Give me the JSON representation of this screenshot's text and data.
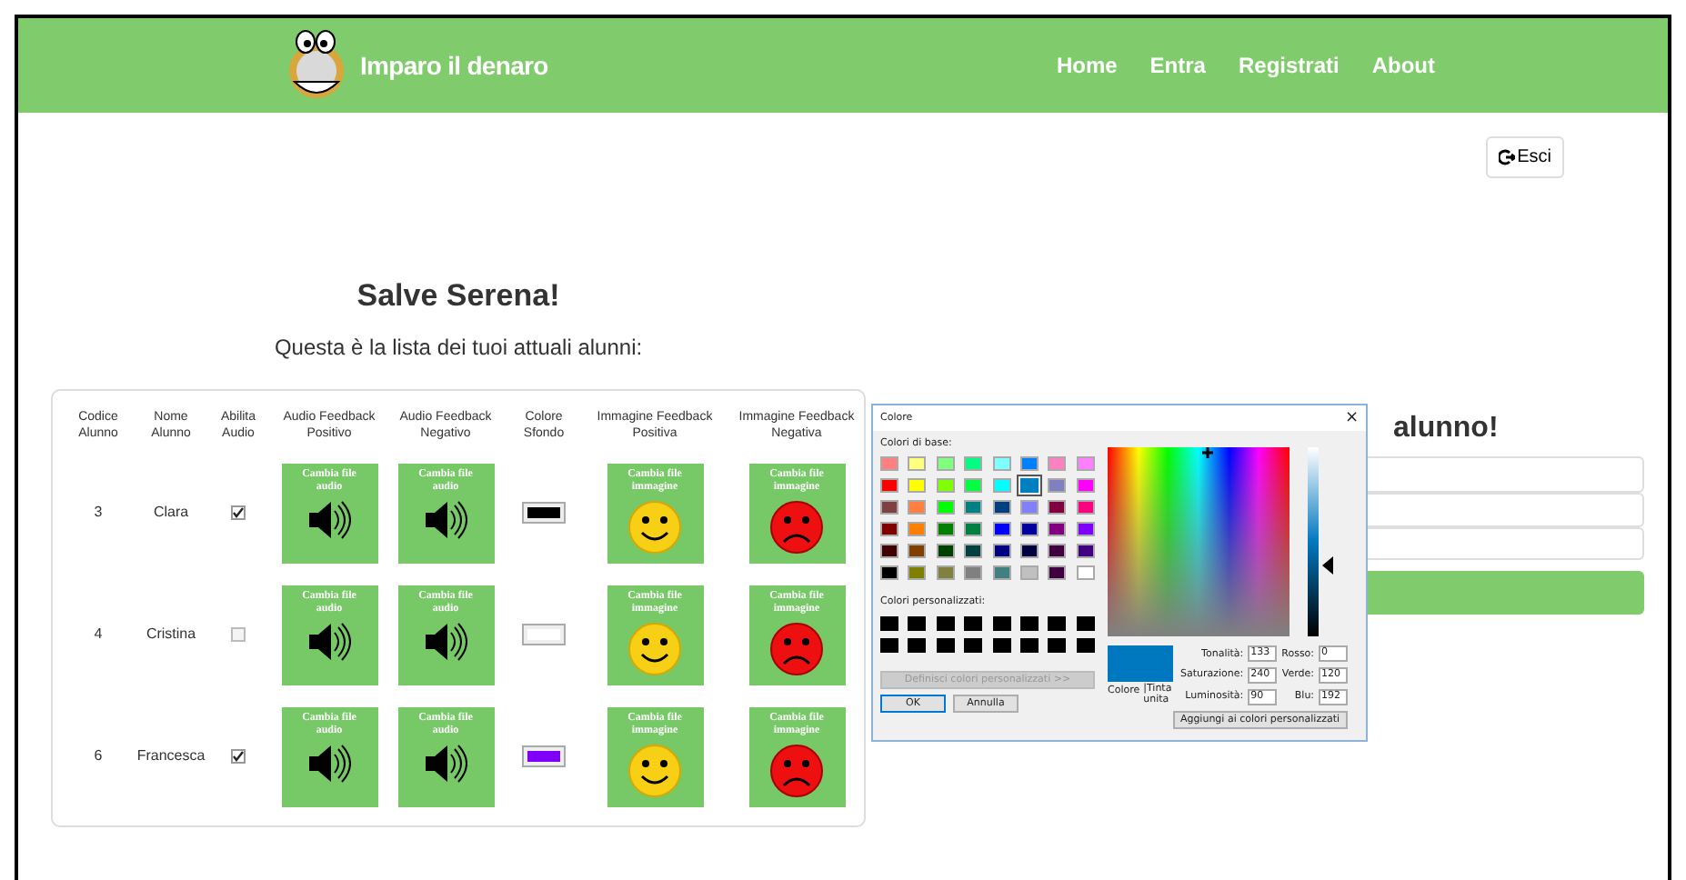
{
  "navbar": {
    "brand": "Imparo il denaro",
    "links": [
      "Home",
      "Entra",
      "Registrati",
      "About"
    ]
  },
  "logout_button": {
    "label": "Esci"
  },
  "greeting": "Salve Serena!",
  "subtitle": "Questa è la lista dei tuoi attuali alunni:",
  "table": {
    "columns": [
      "Codice Alunno",
      "Nome Alunno",
      "Abilita Audio",
      "Audio Feedback Positivo",
      "Audio Feedback Negativo",
      "Colore Sfondo",
      "Immagine Feedback Positiva",
      "Immagine Feedback Negativa"
    ],
    "rows": [
      {
        "code": "3",
        "name": "Clara",
        "audio_enabled": true,
        "audio_positive": "Cambia file audio",
        "audio_negative": "Cambia file audio",
        "color": "#000000",
        "image_positive": "Cambia file immagine",
        "image_negative": "Cambia file immagine"
      },
      {
        "code": "4",
        "name": "Cristina",
        "audio_enabled": false,
        "audio_positive": "Cambia file audio",
        "audio_negative": "Cambia file audio",
        "color": "#ffffff",
        "image_positive": "Cambia file immagine",
        "image_negative": "Cambia file immagine"
      },
      {
        "code": "6",
        "name": "Francesca",
        "audio_enabled": true,
        "audio_positive": "Cambia file audio",
        "audio_negative": "Cambia file audio",
        "color": "#8000ff",
        "image_positive": "Cambia file immagine",
        "image_negative": "Cambia file immagine"
      }
    ]
  },
  "add_form": {
    "title": "alunno!"
  },
  "color_dialog": {
    "title": "Colore",
    "close": "×",
    "basic_label": "Colori di base:",
    "basic_colors": [
      {
        "color": "#ff8080",
        "selected": false
      },
      {
        "color": "#ffff80",
        "selected": false
      },
      {
        "color": "#80ff80",
        "selected": false
      },
      {
        "color": "#00ff80",
        "selected": false
      },
      {
        "color": "#80ffff",
        "selected": false
      },
      {
        "color": "#0080ff",
        "selected": false
      },
      {
        "color": "#ff80c0",
        "selected": false
      },
      {
        "color": "#ff80ff",
        "selected": false
      },
      {
        "color": "#ff0000",
        "selected": false
      },
      {
        "color": "#ffff00",
        "selected": false
      },
      {
        "color": "#80ff00",
        "selected": false
      },
      {
        "color": "#00ff40",
        "selected": false
      },
      {
        "color": "#00ffff",
        "selected": false
      },
      {
        "color": "#0080c0",
        "selected": true
      },
      {
        "color": "#8080c0",
        "selected": false
      },
      {
        "color": "#ff00ff",
        "selected": false
      },
      {
        "color": "#804040",
        "selected": false
      },
      {
        "color": "#ff8040",
        "selected": false
      },
      {
        "color": "#00ff00",
        "selected": false
      },
      {
        "color": "#008080",
        "selected": false
      },
      {
        "color": "#004080",
        "selected": false
      },
      {
        "color": "#8080ff",
        "selected": false
      },
      {
        "color": "#800040",
        "selected": false
      },
      {
        "color": "#ff0080",
        "selected": false
      },
      {
        "color": "#800000",
        "selected": false
      },
      {
        "color": "#ff8000",
        "selected": false
      },
      {
        "color": "#008000",
        "selected": false
      },
      {
        "color": "#008040",
        "selected": false
      },
      {
        "color": "#0000ff",
        "selected": false
      },
      {
        "color": "#0000a0",
        "selected": false
      },
      {
        "color": "#800080",
        "selected": false
      },
      {
        "color": "#8000ff",
        "selected": false
      },
      {
        "color": "#400000",
        "selected": false
      },
      {
        "color": "#804000",
        "selected": false
      },
      {
        "color": "#004000",
        "selected": false
      },
      {
        "color": "#004040",
        "selected": false
      },
      {
        "color": "#000080",
        "selected": false
      },
      {
        "color": "#000040",
        "selected": false
      },
      {
        "color": "#400040",
        "selected": false
      },
      {
        "color": "#400080",
        "selected": false
      },
      {
        "color": "#000000",
        "selected": false
      },
      {
        "color": "#808000",
        "selected": false
      },
      {
        "color": "#808040",
        "selected": false
      },
      {
        "color": "#808080",
        "selected": false
      },
      {
        "color": "#408080",
        "selected": false
      },
      {
        "color": "#c0c0c0",
        "selected": false
      },
      {
        "color": "#400040",
        "selected": false
      },
      {
        "color": "#ffffff",
        "selected": false
      }
    ],
    "custom_label": "Colori personalizzati:",
    "custom_colors": [
      {
        "color": "#000000"
      },
      {
        "color": "#000000"
      },
      {
        "color": "#000000"
      },
      {
        "color": "#000000"
      },
      {
        "color": "#000000"
      },
      {
        "color": "#000000"
      },
      {
        "color": "#000000"
      },
      {
        "color": "#000000"
      },
      {
        "color": "#000000"
      },
      {
        "color": "#000000"
      },
      {
        "color": "#000000"
      },
      {
        "color": "#000000"
      },
      {
        "color": "#000000"
      },
      {
        "color": "#000000"
      },
      {
        "color": "#000000"
      },
      {
        "color": "#000000"
      }
    ],
    "define_button": {
      "label": "Definisci colori personalizzati >>",
      "disabled": true
    },
    "ok_button": "OK",
    "cancel_button": "Annulla",
    "preview": {
      "color": "#0078c0"
    },
    "preview_label": "Colore",
    "solid_label": "|Tinta unita",
    "luminance": {
      "level": 0.375
    },
    "fields": [
      {
        "label": "Tonalità:",
        "value": "133"
      },
      {
        "label": "Rosso:",
        "value": "0"
      },
      {
        "label": "Saturazione:",
        "value": "240"
      },
      {
        "label": "Verde:",
        "value": "120"
      },
      {
        "label": "Luminosità:",
        "value": "90"
      },
      {
        "label": "Blu:",
        "value": "192"
      }
    ],
    "add_button": "Aggiungi ai colori personalizzati"
  }
}
